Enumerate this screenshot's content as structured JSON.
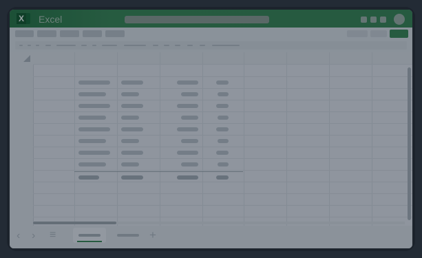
{
  "app": {
    "title": "Excel",
    "logo_letter": "X"
  },
  "colors": {
    "brand": "#2e7a4a",
    "background": "#2a323a"
  },
  "icons": {
    "app_logo": "excel-logo-icon",
    "select_all": "select-all-triangle-icon",
    "prev_sheet": "chevron-left-icon",
    "next_sheet": "chevron-right-icon",
    "sheet_list": "hamburger-icon",
    "add_sheet": "plus-icon"
  },
  "glyphs": {
    "prev": "‹",
    "next": "›",
    "menu": "≡",
    "add": "+"
  }
}
